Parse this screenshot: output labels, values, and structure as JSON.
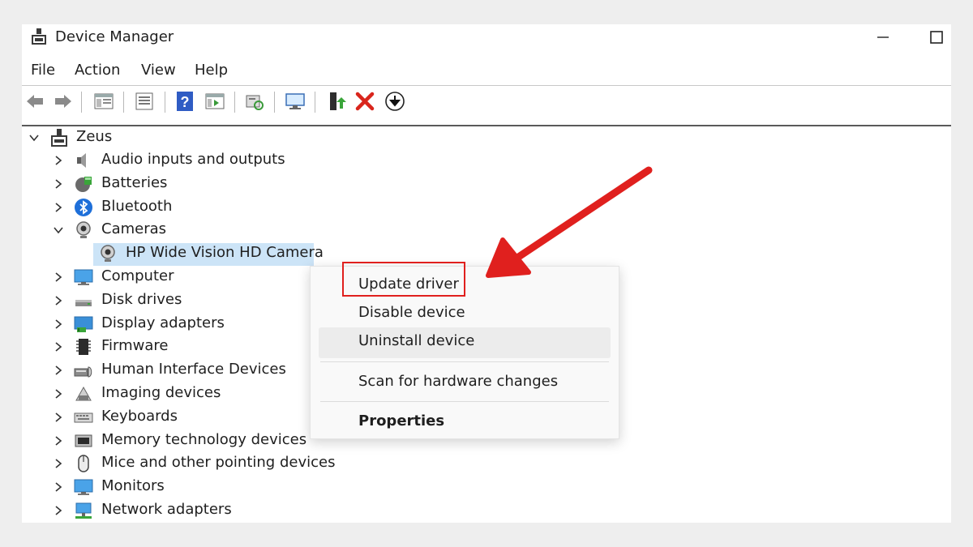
{
  "window": {
    "title": "Device Manager"
  },
  "menu": [
    {
      "label": "File"
    },
    {
      "label": "Action"
    },
    {
      "label": "View"
    },
    {
      "label": "Help"
    }
  ],
  "toolbar": {
    "buttons": [
      "back-icon",
      "forward-icon",
      "show-hide-console-tree-icon",
      "properties-icon",
      "help-icon",
      "action-pane-icon",
      "scan-hardware-icon",
      "monitor-icon",
      "update-driver-icon",
      "uninstall-icon",
      "download-icon"
    ]
  },
  "tree": {
    "root": {
      "label": "Zeus",
      "expanded": true
    },
    "items": [
      {
        "label": "Audio inputs and outputs",
        "expanded": false
      },
      {
        "label": "Batteries",
        "expanded": false
      },
      {
        "label": "Bluetooth",
        "expanded": false
      },
      {
        "label": "Cameras",
        "expanded": true
      },
      {
        "label": "HP Wide Vision HD Camera",
        "child": true,
        "selected": true
      },
      {
        "label": "Computer",
        "expanded": false
      },
      {
        "label": "Disk drives",
        "expanded": false
      },
      {
        "label": "Display adapters",
        "expanded": false
      },
      {
        "label": "Firmware",
        "expanded": false
      },
      {
        "label": "Human Interface Devices",
        "expanded": false
      },
      {
        "label": "Imaging devices",
        "expanded": false
      },
      {
        "label": "Keyboards",
        "expanded": false
      },
      {
        "label": "Memory technology devices",
        "expanded": false
      },
      {
        "label": "Mice and other pointing devices",
        "expanded": false
      },
      {
        "label": "Monitors",
        "expanded": false
      },
      {
        "label": "Network adapters",
        "expanded": false
      }
    ]
  },
  "context_menu": {
    "items": [
      {
        "label": "Update driver"
      },
      {
        "label": "Disable device"
      },
      {
        "label": "Uninstall device"
      },
      {
        "label": "Scan for hardware changes"
      },
      {
        "label": "Properties"
      }
    ]
  },
  "colors": {
    "selection": "#cce4f7",
    "annotation_red": "#e0201e",
    "delete_red": "#d9251c"
  }
}
